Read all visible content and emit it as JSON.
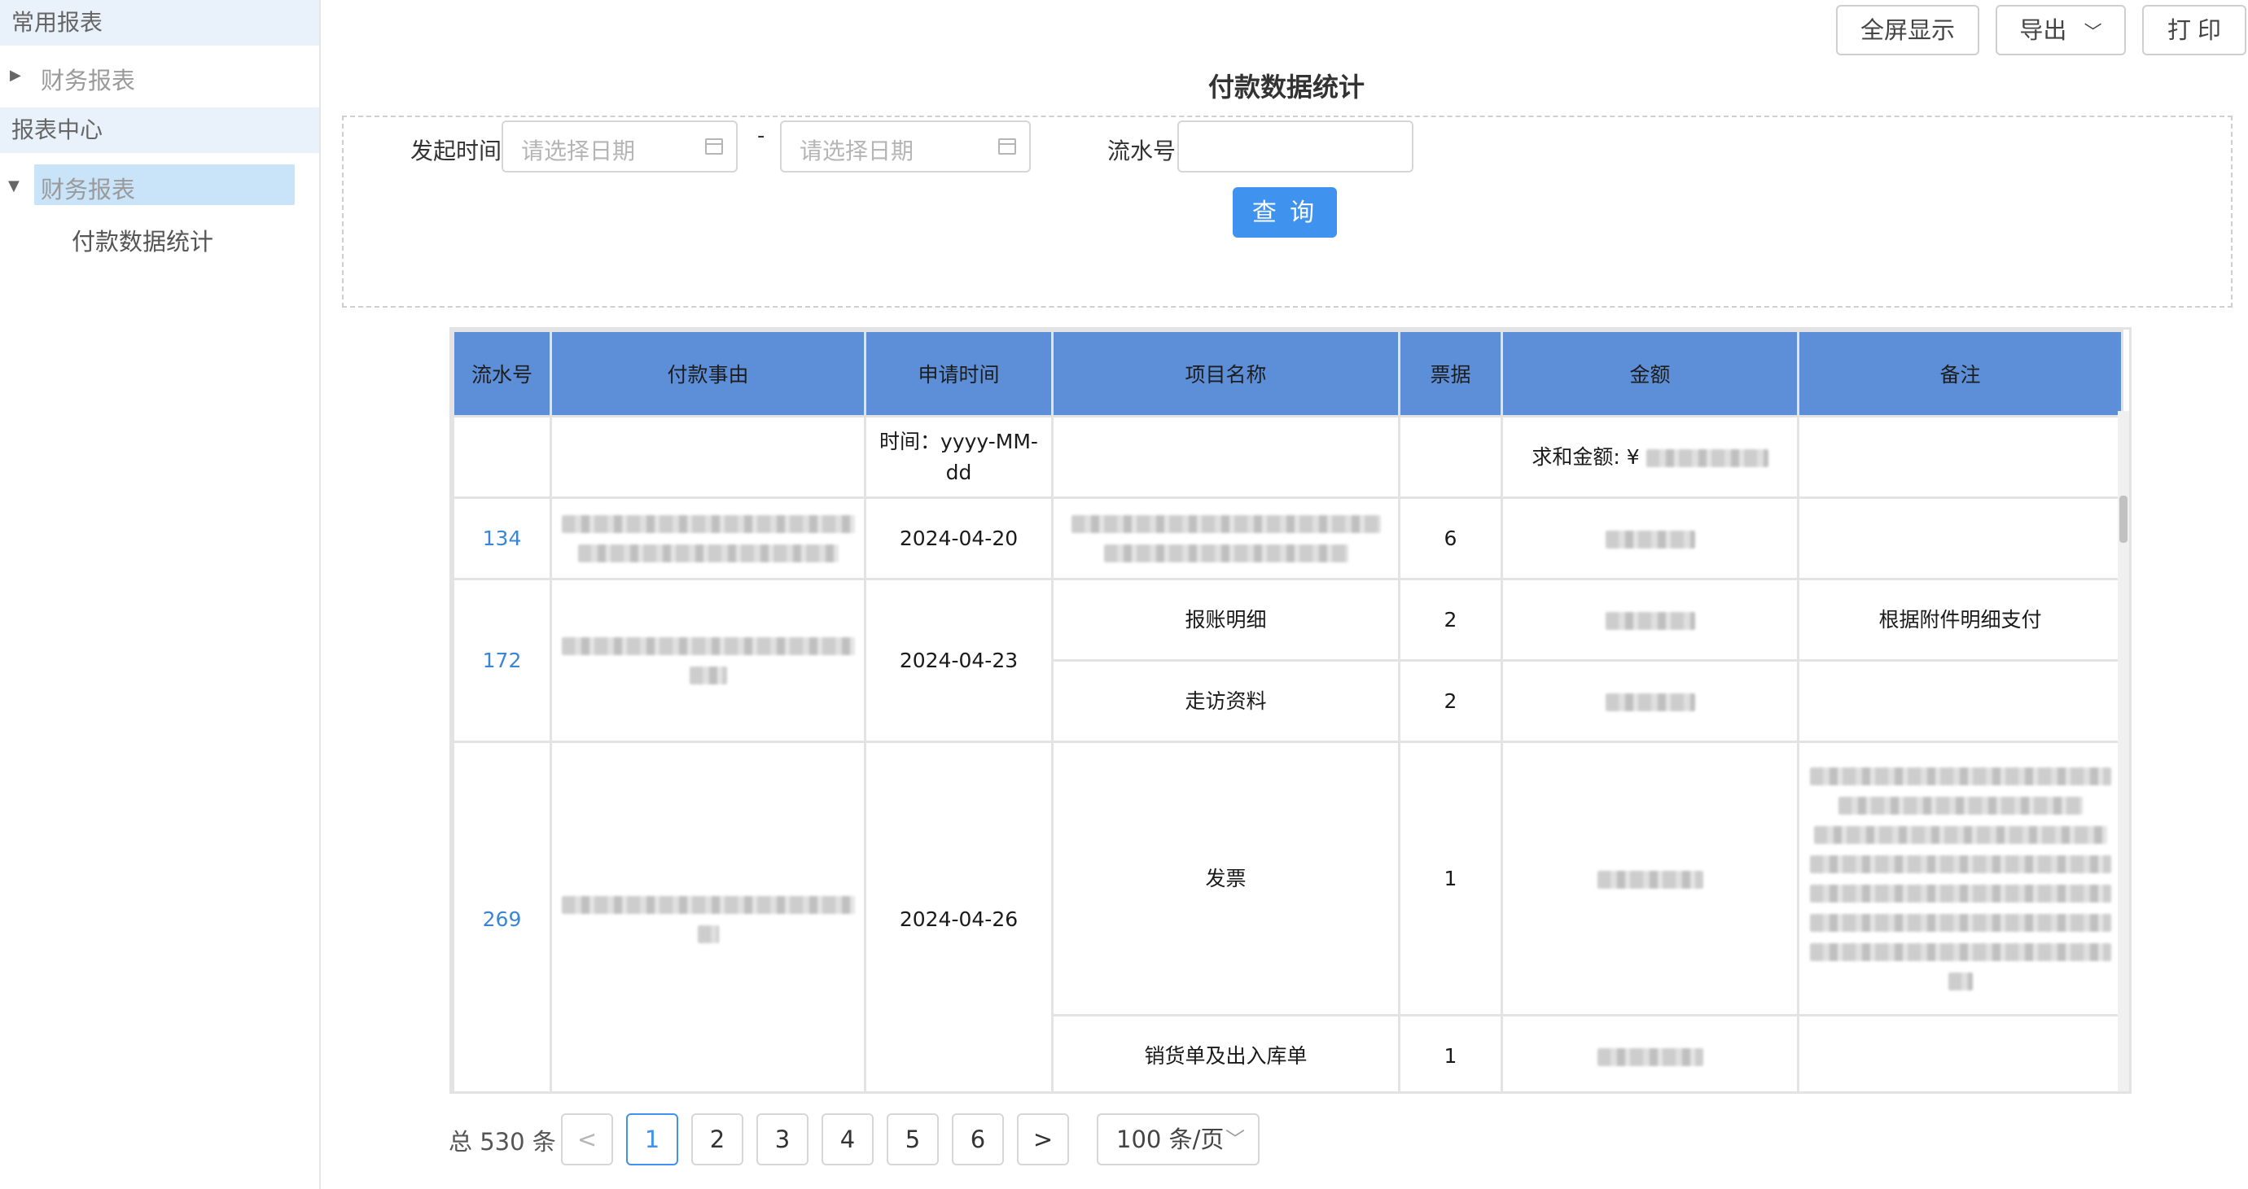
{
  "sidebar": {
    "section1": "常用报表",
    "section1_item": "财务报表",
    "section2": "报表中心",
    "section2_item": "财务报表",
    "leaf": "付款数据统计"
  },
  "toolbar": {
    "fullscreen": "全屏显示",
    "export": "导出",
    "print": "打 印"
  },
  "page": {
    "title": "付款数据统计"
  },
  "search": {
    "start_label": "发起时间",
    "date_placeholder": "请选择日期",
    "separator": "-",
    "serial_label": "流水号",
    "serial_value": "",
    "query_button": "查 询"
  },
  "table": {
    "headers": [
      "流水号",
      "付款事由",
      "申请时间",
      "项目名称",
      "票据",
      "金额",
      "备注"
    ],
    "summary": {
      "time_hint": "时间：yyyy-MM-dd",
      "sum_label": "求和金额: ¥"
    },
    "rows": [
      {
        "serial": "134",
        "date": "2024-04-20",
        "items": [
          {
            "name": "",
            "count": "6",
            "remark": ""
          }
        ]
      },
      {
        "serial": "172",
        "date": "2024-04-23",
        "items": [
          {
            "name": "报账明细",
            "count": "2",
            "remark": "根据附件明细支付"
          },
          {
            "name": "走访资料",
            "count": "2",
            "remark": ""
          }
        ]
      },
      {
        "serial": "269",
        "date": "2024-04-26",
        "items": [
          {
            "name": "发票",
            "count": "1",
            "remark": ""
          },
          {
            "name": "销货单及出入库单",
            "count": "1",
            "remark": ""
          }
        ]
      }
    ]
  },
  "pagination": {
    "total": "总 530 条",
    "prev": "<",
    "next": ">",
    "pages": [
      "1",
      "2",
      "3",
      "4",
      "5",
      "6"
    ],
    "current": "1",
    "page_size": "100 条/页"
  },
  "colors": {
    "accent": "#3f92ee",
    "header_bg": "#5d8fd9",
    "sidebar_section_bg": "#e9f1fa",
    "sidebar_active_bg": "#c9e3f8",
    "link": "#3a86d6"
  }
}
